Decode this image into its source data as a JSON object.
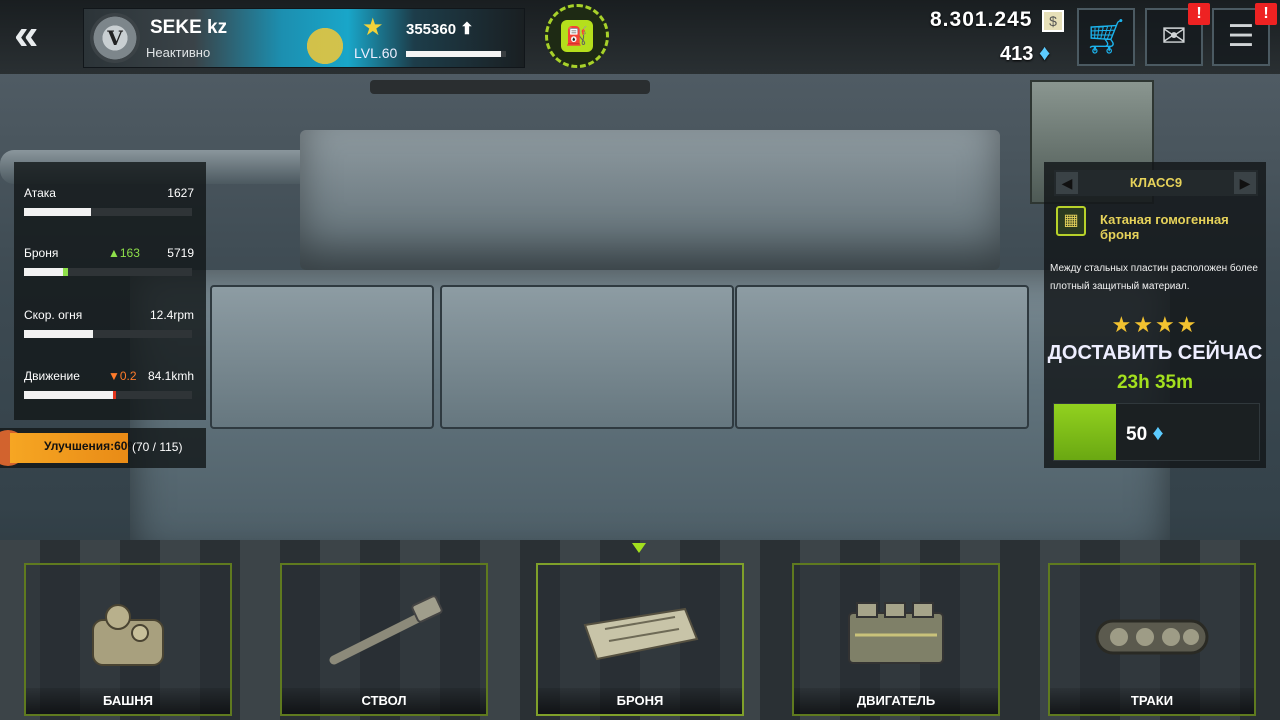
{
  "header": {
    "back_icon": "double-chevron-left-icon",
    "rank_badge": "V",
    "player_name": "SEKE kz",
    "player_status": "Неактивно",
    "level": "LVL.60",
    "xp": "355360",
    "xp_progress": 0.95,
    "money": "8.301.245",
    "gems": "413",
    "mail_alert": "!",
    "chat_alert": "!"
  },
  "stats": [
    {
      "label": "Атака",
      "delta": "",
      "value": "1627",
      "fill": 0.4,
      "ext": 0
    },
    {
      "label": "Броня",
      "delta": "▲163",
      "delta_dir": "up",
      "value": "5719",
      "fill": 0.23,
      "ext": 0.03
    },
    {
      "label": "Скор. огня",
      "delta": "",
      "value": "12.4rpm",
      "fill": 0.41,
      "ext": 0
    },
    {
      "label": "Движение",
      "delta": "▼0.2",
      "delta_dir": "down",
      "value": "84.1kmh",
      "fill": 0.53,
      "ext": 0.02
    }
  ],
  "upgrade": {
    "label": "Улучшения:60%",
    "count": "(70 / 115)",
    "progress": 0.6
  },
  "item": {
    "class_label": "КЛАСС9",
    "name": "Катаная гомогенная броня",
    "description": "Между стальных пластин расположен более плотный защитный материал.",
    "stars": "★★★★",
    "deliver_label": "ДОСТАВИТЬ СЕЙЧАС",
    "timer": "23h 35m",
    "price": "50"
  },
  "parts": [
    {
      "label": "БАШНЯ",
      "icon": "turret-icon"
    },
    {
      "label": "СТВОЛ",
      "icon": "barrel-icon"
    },
    {
      "label": "БРОНЯ",
      "icon": "armor-icon"
    },
    {
      "label": "ДВИГАТЕЛЬ",
      "icon": "engine-icon"
    },
    {
      "label": "ТРАКИ",
      "icon": "tracks-icon"
    }
  ],
  "colors": {
    "accent": "#a3e01e",
    "gold": "#e6d25a",
    "gem": "#5ccbff",
    "alert": "#e22222",
    "upgrade": "#f6a623"
  }
}
